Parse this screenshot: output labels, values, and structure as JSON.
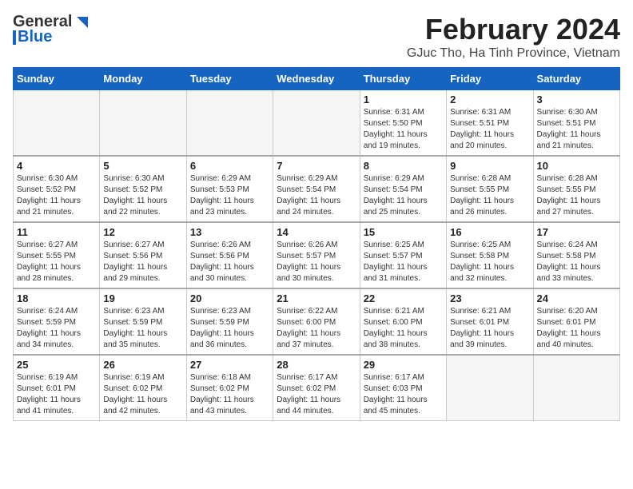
{
  "header": {
    "logo_general": "General",
    "logo_blue": "Blue",
    "title": "February 2024",
    "subtitle": "GJuc Tho, Ha Tinh Province, Vietnam"
  },
  "days_of_week": [
    "Sunday",
    "Monday",
    "Tuesday",
    "Wednesday",
    "Thursday",
    "Friday",
    "Saturday"
  ],
  "weeks": [
    [
      {
        "day": "",
        "info": ""
      },
      {
        "day": "",
        "info": ""
      },
      {
        "day": "",
        "info": ""
      },
      {
        "day": "",
        "info": ""
      },
      {
        "day": "1",
        "info": "Sunrise: 6:31 AM\nSunset: 5:50 PM\nDaylight: 11 hours\nand 19 minutes."
      },
      {
        "day": "2",
        "info": "Sunrise: 6:31 AM\nSunset: 5:51 PM\nDaylight: 11 hours\nand 20 minutes."
      },
      {
        "day": "3",
        "info": "Sunrise: 6:30 AM\nSunset: 5:51 PM\nDaylight: 11 hours\nand 21 minutes."
      }
    ],
    [
      {
        "day": "4",
        "info": "Sunrise: 6:30 AM\nSunset: 5:52 PM\nDaylight: 11 hours\nand 21 minutes."
      },
      {
        "day": "5",
        "info": "Sunrise: 6:30 AM\nSunset: 5:52 PM\nDaylight: 11 hours\nand 22 minutes."
      },
      {
        "day": "6",
        "info": "Sunrise: 6:29 AM\nSunset: 5:53 PM\nDaylight: 11 hours\nand 23 minutes."
      },
      {
        "day": "7",
        "info": "Sunrise: 6:29 AM\nSunset: 5:54 PM\nDaylight: 11 hours\nand 24 minutes."
      },
      {
        "day": "8",
        "info": "Sunrise: 6:29 AM\nSunset: 5:54 PM\nDaylight: 11 hours\nand 25 minutes."
      },
      {
        "day": "9",
        "info": "Sunrise: 6:28 AM\nSunset: 5:55 PM\nDaylight: 11 hours\nand 26 minutes."
      },
      {
        "day": "10",
        "info": "Sunrise: 6:28 AM\nSunset: 5:55 PM\nDaylight: 11 hours\nand 27 minutes."
      }
    ],
    [
      {
        "day": "11",
        "info": "Sunrise: 6:27 AM\nSunset: 5:55 PM\nDaylight: 11 hours\nand 28 minutes."
      },
      {
        "day": "12",
        "info": "Sunrise: 6:27 AM\nSunset: 5:56 PM\nDaylight: 11 hours\nand 29 minutes."
      },
      {
        "day": "13",
        "info": "Sunrise: 6:26 AM\nSunset: 5:56 PM\nDaylight: 11 hours\nand 30 minutes."
      },
      {
        "day": "14",
        "info": "Sunrise: 6:26 AM\nSunset: 5:57 PM\nDaylight: 11 hours\nand 30 minutes."
      },
      {
        "day": "15",
        "info": "Sunrise: 6:25 AM\nSunset: 5:57 PM\nDaylight: 11 hours\nand 31 minutes."
      },
      {
        "day": "16",
        "info": "Sunrise: 6:25 AM\nSunset: 5:58 PM\nDaylight: 11 hours\nand 32 minutes."
      },
      {
        "day": "17",
        "info": "Sunrise: 6:24 AM\nSunset: 5:58 PM\nDaylight: 11 hours\nand 33 minutes."
      }
    ],
    [
      {
        "day": "18",
        "info": "Sunrise: 6:24 AM\nSunset: 5:59 PM\nDaylight: 11 hours\nand 34 minutes."
      },
      {
        "day": "19",
        "info": "Sunrise: 6:23 AM\nSunset: 5:59 PM\nDaylight: 11 hours\nand 35 minutes."
      },
      {
        "day": "20",
        "info": "Sunrise: 6:23 AM\nSunset: 5:59 PM\nDaylight: 11 hours\nand 36 minutes."
      },
      {
        "day": "21",
        "info": "Sunrise: 6:22 AM\nSunset: 6:00 PM\nDaylight: 11 hours\nand 37 minutes."
      },
      {
        "day": "22",
        "info": "Sunrise: 6:21 AM\nSunset: 6:00 PM\nDaylight: 11 hours\nand 38 minutes."
      },
      {
        "day": "23",
        "info": "Sunrise: 6:21 AM\nSunset: 6:01 PM\nDaylight: 11 hours\nand 39 minutes."
      },
      {
        "day": "24",
        "info": "Sunrise: 6:20 AM\nSunset: 6:01 PM\nDaylight: 11 hours\nand 40 minutes."
      }
    ],
    [
      {
        "day": "25",
        "info": "Sunrise: 6:19 AM\nSunset: 6:01 PM\nDaylight: 11 hours\nand 41 minutes."
      },
      {
        "day": "26",
        "info": "Sunrise: 6:19 AM\nSunset: 6:02 PM\nDaylight: 11 hours\nand 42 minutes."
      },
      {
        "day": "27",
        "info": "Sunrise: 6:18 AM\nSunset: 6:02 PM\nDaylight: 11 hours\nand 43 minutes."
      },
      {
        "day": "28",
        "info": "Sunrise: 6:17 AM\nSunset: 6:02 PM\nDaylight: 11 hours\nand 44 minutes."
      },
      {
        "day": "29",
        "info": "Sunrise: 6:17 AM\nSunset: 6:03 PM\nDaylight: 11 hours\nand 45 minutes."
      },
      {
        "day": "",
        "info": ""
      },
      {
        "day": "",
        "info": ""
      }
    ]
  ]
}
